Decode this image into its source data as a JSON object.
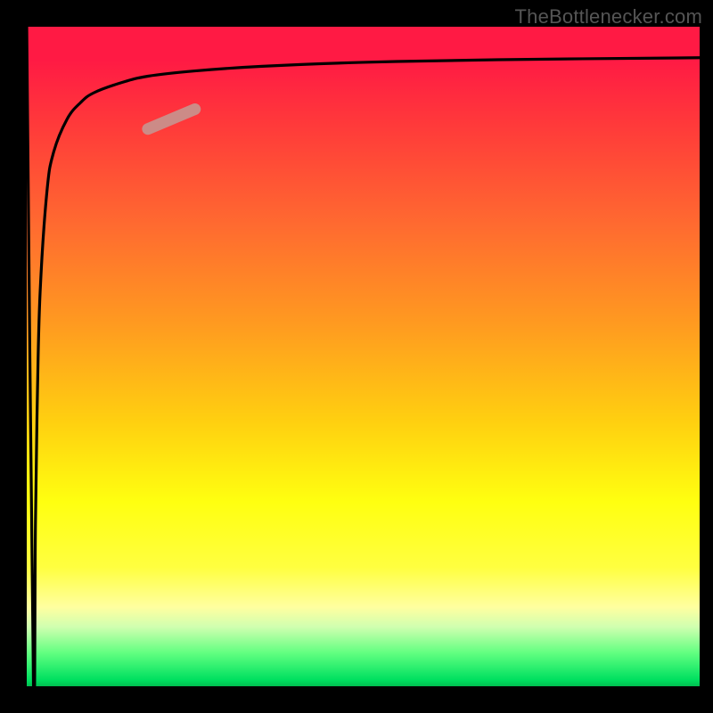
{
  "watermark": "TheBottlenecker.com",
  "chart_data": {
    "type": "line",
    "title": "",
    "xlabel": "",
    "ylabel": "",
    "xlim": [
      0,
      100
    ],
    "ylim": [
      0,
      100
    ],
    "grid": false,
    "series": [
      {
        "name": "bottleneck-curve",
        "x": [
          0,
          1,
          1.3,
          1.6,
          2,
          3,
          4,
          6,
          8,
          10,
          14,
          18,
          25,
          35,
          50,
          70,
          100
        ],
        "y": [
          100,
          0,
          25,
          45,
          60,
          75,
          81,
          86,
          88.5,
          90,
          91.5,
          92.5,
          93.3,
          94,
          94.6,
          95,
          95.3
        ]
      },
      {
        "name": "highlight-segment",
        "x": [
          18,
          25
        ],
        "y": [
          84.5,
          87.5
        ]
      }
    ],
    "colors": {
      "gradient_top": "#ff1a44",
      "gradient_mid": "#ffff10",
      "gradient_bottom": "#00e060",
      "curve": "#000000",
      "highlight": "#cc8b87"
    },
    "annotations": []
  }
}
